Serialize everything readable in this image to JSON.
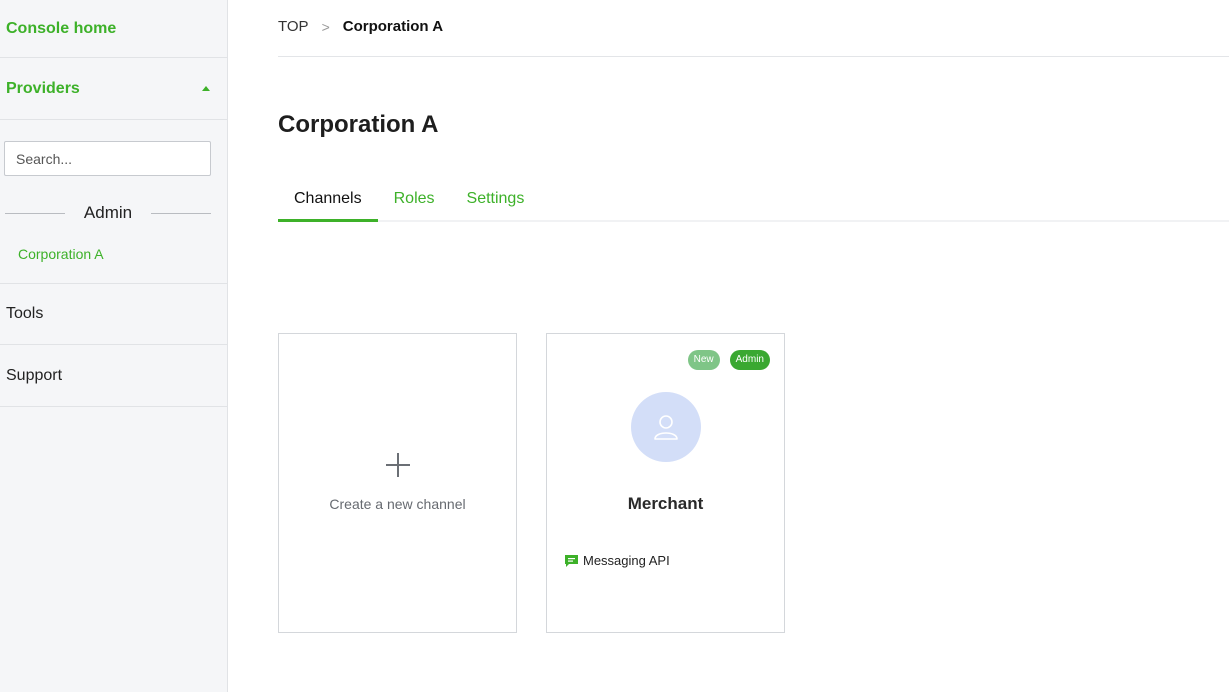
{
  "sidebar": {
    "console_home": "Console home",
    "providers": "Providers",
    "search_placeholder": "Search...",
    "admin_heading": "Admin",
    "provider_item": "Corporation A",
    "tools": "Tools",
    "support": "Support"
  },
  "breadcrumb": {
    "root": "TOP",
    "separator": ">",
    "current": "Corporation A"
  },
  "page": {
    "title": "Corporation A"
  },
  "tabs": [
    {
      "label": "Channels",
      "active": true
    },
    {
      "label": "Roles",
      "active": false
    },
    {
      "label": "Settings",
      "active": false
    }
  ],
  "cards": {
    "create_label": "Create a new channel",
    "channel": {
      "badge_new": "New",
      "badge_admin": "Admin",
      "name": "Merchant",
      "type": "Messaging API"
    }
  },
  "colors": {
    "accent": "#3db129",
    "avatar_bg": "#d3def8",
    "badge_new": "#7fc587",
    "badge_admin": "#3aa831"
  }
}
